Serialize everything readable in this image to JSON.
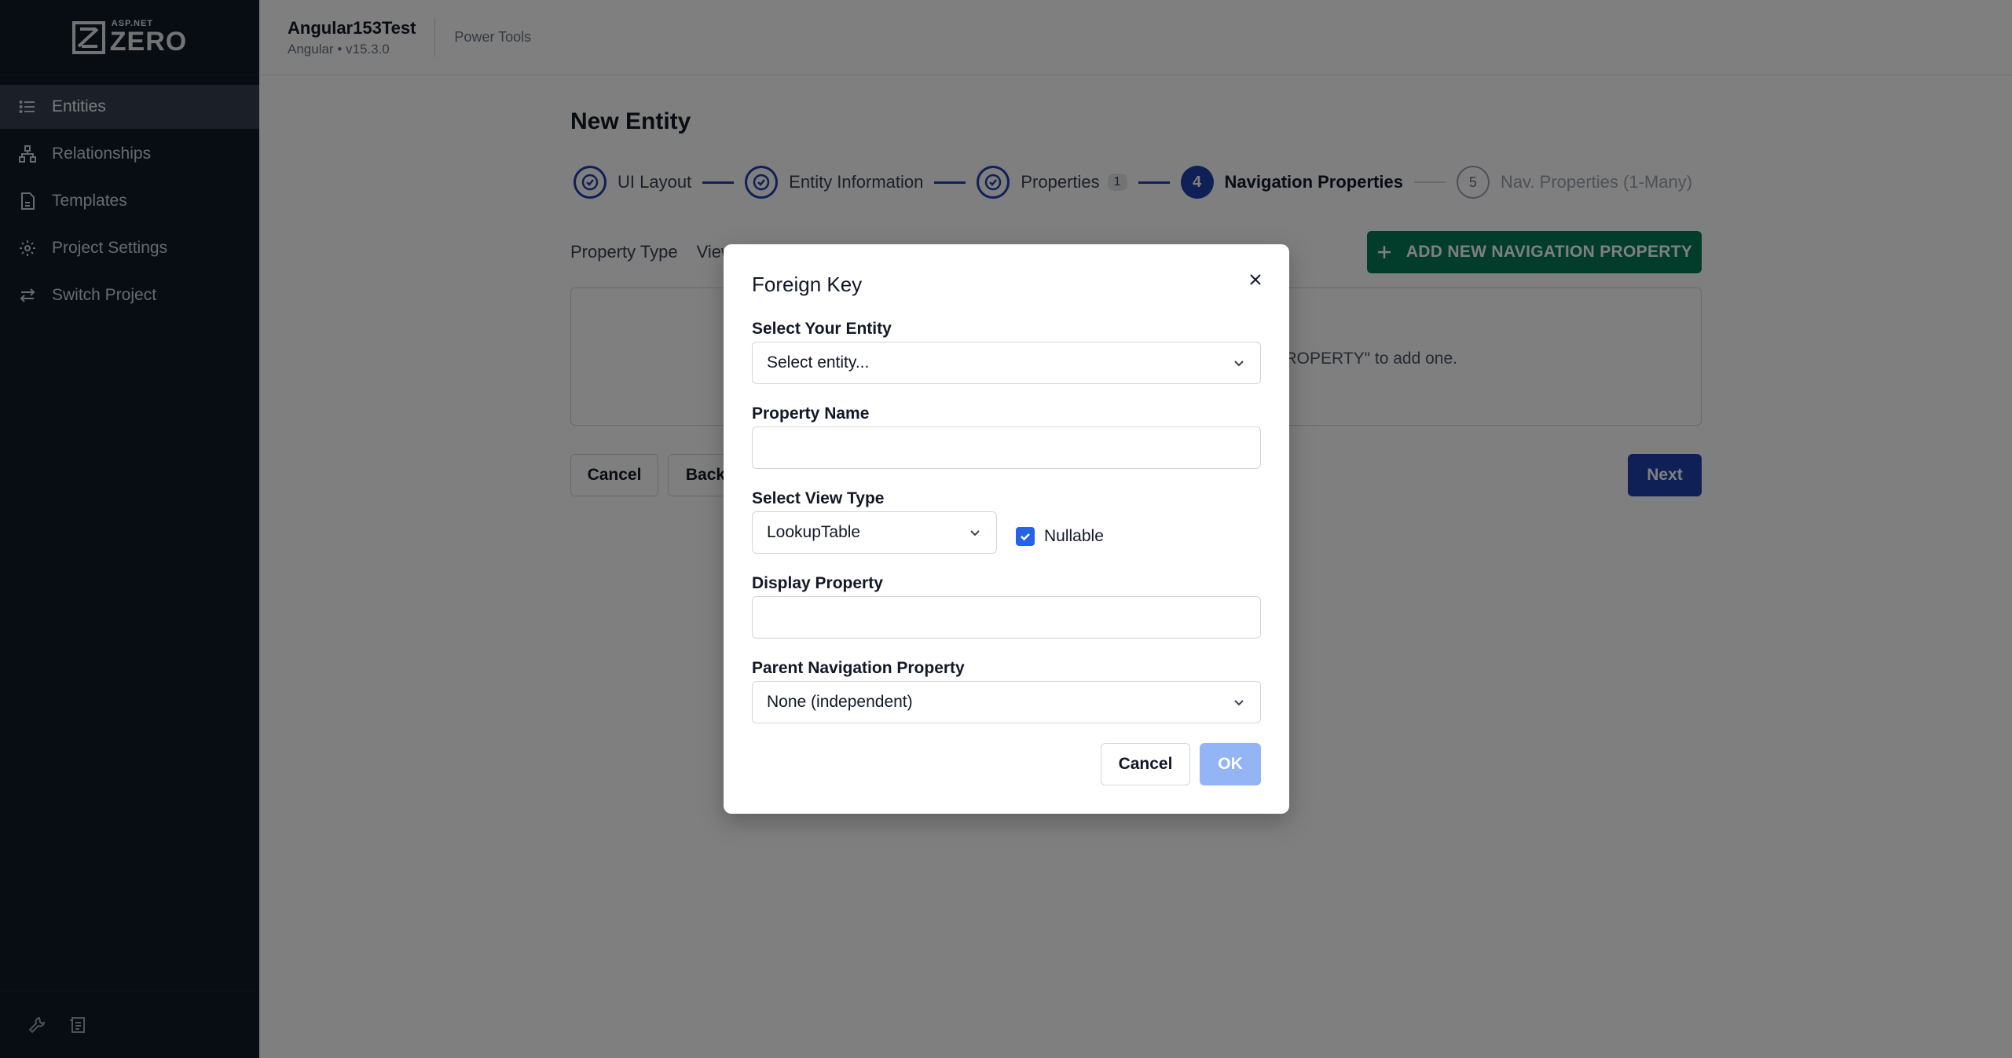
{
  "sidebar": {
    "logo_small": "ASP.NET",
    "logo_big": "ZERO",
    "items": [
      {
        "label": "Entities",
        "icon": "list-icon"
      },
      {
        "label": "Relationships",
        "icon": "hierarchy-icon"
      },
      {
        "label": "Templates",
        "icon": "document-icon"
      },
      {
        "label": "Project Settings",
        "icon": "gear-icon"
      },
      {
        "label": "Switch Project",
        "icon": "swap-icon"
      }
    ]
  },
  "header": {
    "project_name": "Angular153Test",
    "project_sub": "Angular • v15.3.0",
    "power_tools": "Power Tools"
  },
  "page": {
    "title": "New Entity",
    "steps": [
      {
        "label": "UI Layout",
        "state": "done"
      },
      {
        "label": "Entity Information",
        "state": "done"
      },
      {
        "label": "Properties",
        "state": "done",
        "badge": "1"
      },
      {
        "label": "Navigation Properties",
        "state": "current",
        "number": "4"
      },
      {
        "label": "Nav. Properties (1-Many)",
        "state": "pending",
        "number": "5"
      }
    ],
    "tab_property_type": "Property Type",
    "tab_view": "View",
    "add_button": "ADD NEW NAVIGATION PROPERTY",
    "empty_hint": "PROPERTY\" to add one.",
    "cancel": "Cancel",
    "back": "Back",
    "next": "Next"
  },
  "modal": {
    "title": "Foreign Key",
    "entity_label": "Select Your Entity",
    "entity_value": "Select entity...",
    "property_name_label": "Property Name",
    "property_name_value": "",
    "view_type_label": "Select View Type",
    "view_type_value": "LookupTable",
    "nullable_label": "Nullable",
    "nullable_checked": true,
    "display_property_label": "Display Property",
    "display_property_value": "",
    "parent_nav_label": "Parent Navigation Property",
    "parent_nav_value": "None (independent)",
    "cancel": "Cancel",
    "ok": "OK"
  },
  "colors": {
    "sidebar_bg": "#111827",
    "primary": "#1e40af",
    "success": "#047857",
    "ok_disabled": "#93b4f5"
  }
}
